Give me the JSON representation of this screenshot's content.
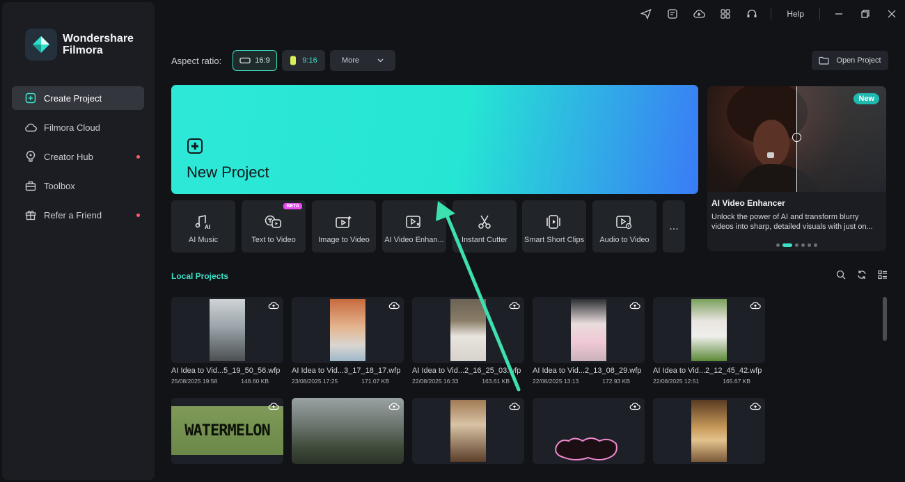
{
  "app": {
    "logo_line1": "Wondershare",
    "logo_line2": "Filmora"
  },
  "sidebar": {
    "items": [
      {
        "label": "Create Project",
        "icon": "plus-square-icon",
        "active": true,
        "dot": false
      },
      {
        "label": "Filmora Cloud",
        "icon": "cloud-icon",
        "active": false,
        "dot": false
      },
      {
        "label": "Creator Hub",
        "icon": "bulb-icon",
        "active": false,
        "dot": true
      },
      {
        "label": "Toolbox",
        "icon": "toolbox-icon",
        "active": false,
        "dot": false
      },
      {
        "label": "Refer a Friend",
        "icon": "gift-icon",
        "active": false,
        "dot": true
      }
    ]
  },
  "titlebar": {
    "help": "Help"
  },
  "aspect": {
    "label": "Aspect ratio:",
    "options": [
      {
        "label": "16:9",
        "selected": true
      },
      {
        "label": "9:16",
        "selected": false
      }
    ],
    "more": "More"
  },
  "open_project": "Open Project",
  "new_project": {
    "title": "New Project"
  },
  "tools": [
    {
      "label": "AI Music",
      "icon": "ai-music-icon",
      "badge": ""
    },
    {
      "label": "Text to Video",
      "icon": "text-to-video-icon",
      "badge": "BETA"
    },
    {
      "label": "Image to Video",
      "icon": "image-to-video-icon",
      "badge": ""
    },
    {
      "label": "AI Video Enhan...",
      "icon": "ai-video-enhancer-icon",
      "badge": ""
    },
    {
      "label": "Instant Cutter",
      "icon": "scissors-icon",
      "badge": ""
    },
    {
      "label": "Smart Short Clips",
      "icon": "smart-clips-icon",
      "badge": ""
    },
    {
      "label": "Audio to Video",
      "icon": "audio-to-video-icon",
      "badge": ""
    }
  ],
  "more_tools": "...",
  "promo": {
    "badge": "New",
    "title": "AI Video Enhancer",
    "description": "Unlock the power of AI and transform blurry videos into sharp, detailed visuals with just on...",
    "slides": 6,
    "active_slide": 1
  },
  "local_projects": {
    "title": "Local Projects",
    "projects": [
      {
        "name": "AI Idea to Vid...5_19_50_56.wfp",
        "date": "25/08/2025 19:58",
        "size": "148.60 KB"
      },
      {
        "name": "AI Idea to Vid...3_17_18_17.wfp",
        "date": "23/08/2025 17:25",
        "size": "171.07 KB"
      },
      {
        "name": "AI Idea to Vid...2_16_25_03.wfp",
        "date": "22/08/2025 16:33",
        "size": "163.61 KB"
      },
      {
        "name": "AI Idea to Vid...2_13_08_29.wfp",
        "date": "22/08/2025 13:13",
        "size": "172.93 KB"
      },
      {
        "name": "AI Idea to Vid...2_12_45_42.wfp",
        "date": "22/08/2025 12:51",
        "size": "165.67 KB"
      }
    ],
    "thumb_text": "WATERMELON"
  },
  "colors": {
    "accent": "#3de0c6",
    "banner_start": "#2ee8d7",
    "banner_end": "#3a7bf6",
    "dot": "#ff5b6a",
    "beta": "#e84cf0"
  }
}
